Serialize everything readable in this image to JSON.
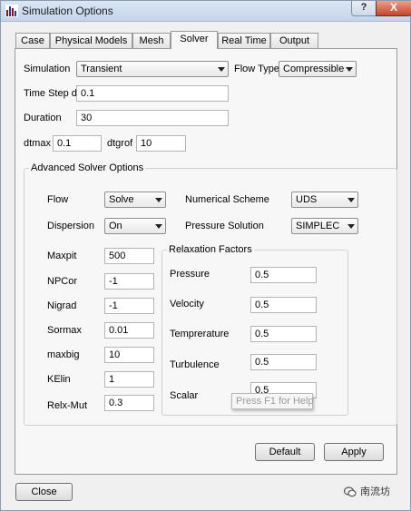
{
  "window": {
    "title": "Simulation Options",
    "help_label": "?",
    "close_label": "X"
  },
  "tabs": [
    "Case",
    "Physical Models",
    "Mesh",
    "Solver",
    "Real Time",
    "Output"
  ],
  "active_tab": "Solver",
  "solver": {
    "simulation": {
      "label": "Simulation",
      "value": "Transient"
    },
    "flow_type": {
      "label": "Flow Type",
      "value": "Compressible"
    },
    "time_step": {
      "label": "Time Step dt",
      "value": "0.1"
    },
    "duration": {
      "label": "Duration",
      "value": "30"
    },
    "dtmax": {
      "label": "dtmax",
      "value": "0.1"
    },
    "dtgrof": {
      "label": "dtgrof",
      "value": "10"
    }
  },
  "advanced": {
    "title": "Advanced Solver Options",
    "flow": {
      "label": "Flow",
      "value": "Solve"
    },
    "numerical_scheme": {
      "label": "Numerical Scheme",
      "value": "UDS"
    },
    "dispersion": {
      "label": "Dispersion",
      "value": "On"
    },
    "pressure_solution": {
      "label": "Pressure Solution",
      "value": "SIMPLEC"
    },
    "maxpit": {
      "label": "Maxpit",
      "value": "500"
    },
    "npcor": {
      "label": "NPCor",
      "value": "-1"
    },
    "nigrad": {
      "label": "Nigrad",
      "value": "-1"
    },
    "sormax": {
      "label": "Sormax",
      "value": "0.01"
    },
    "maxbig": {
      "label": "maxbig",
      "value": "10"
    },
    "kelin": {
      "label": "KElin",
      "value": "1"
    },
    "relx_mut": {
      "label": "Relx-Mut",
      "value": "0.3"
    }
  },
  "relaxation": {
    "title": "Relaxation Factors",
    "pressure": {
      "label": "Pressure",
      "value": "0.5"
    },
    "velocity": {
      "label": "Velocity",
      "value": "0.5"
    },
    "temperature": {
      "label": "Temprerature",
      "value": "0.5"
    },
    "turbulence": {
      "label": "Turbulence",
      "value": "0.5"
    },
    "scalar": {
      "label": "Scalar",
      "value": "0.5"
    }
  },
  "tooltip": "Press F1 for Help",
  "buttons": {
    "default": "Default",
    "apply": "Apply",
    "close": "Close"
  },
  "watermark": "南流坊"
}
